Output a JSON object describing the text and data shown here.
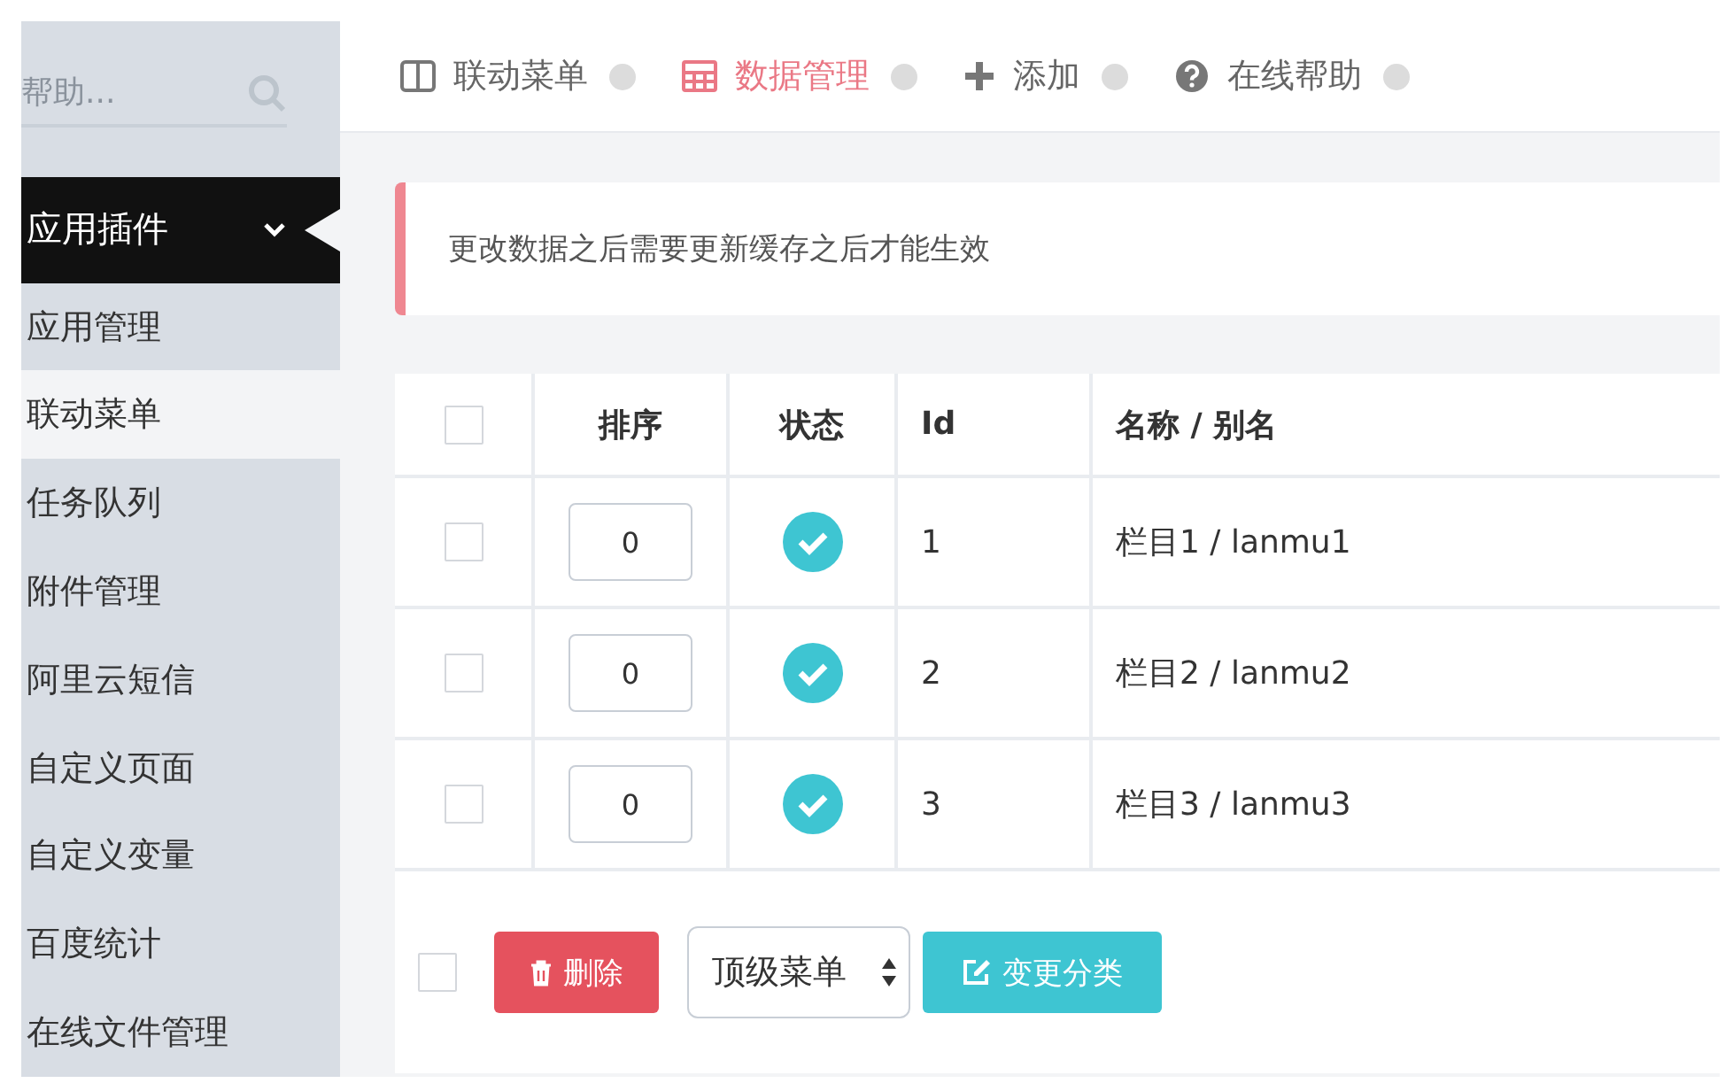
{
  "sidebar": {
    "search": {
      "placeholder": "帮助..."
    },
    "group": {
      "label": "应用插件",
      "expanded": true
    },
    "items": [
      {
        "label": "应用管理",
        "selected": false
      },
      {
        "label": "联动菜单",
        "selected": true
      },
      {
        "label": "任务队列",
        "selected": false
      },
      {
        "label": "附件管理",
        "selected": false
      },
      {
        "label": "阿里云短信",
        "selected": false
      },
      {
        "label": "自定义页面",
        "selected": false
      },
      {
        "label": "自定义变量",
        "selected": false
      },
      {
        "label": "百度统计",
        "selected": false
      },
      {
        "label": "在线文件管理",
        "selected": false
      }
    ]
  },
  "nav": [
    {
      "kind": "columns",
      "label": "联动菜单",
      "selected": false
    },
    {
      "kind": "table",
      "label": "数据管理",
      "selected": true
    },
    {
      "kind": "plus",
      "label": "添加",
      "selected": false
    },
    {
      "kind": "help",
      "label": "在线帮助",
      "selected": false
    }
  ],
  "alert": "更改数据之后需要更新缓存之后才能生效",
  "table": {
    "select_all": {
      "checked": false
    },
    "columns": [
      "排序",
      "状态",
      "Id",
      "名称 / 别名"
    ],
    "rows": [
      {
        "checked": false,
        "order": "0",
        "status": true,
        "id": "1",
        "name": "栏目1 / lanmu1"
      },
      {
        "checked": false,
        "order": "0",
        "status": true,
        "id": "2",
        "name": "栏目2 / lanmu2"
      },
      {
        "checked": false,
        "order": "0",
        "status": true,
        "id": "3",
        "name": "栏目3 / lanmu3"
      }
    ]
  },
  "footer": {
    "checked": false,
    "delete_button": "删除",
    "parent_select": "顶级菜单",
    "change_button": "变更分类"
  }
}
